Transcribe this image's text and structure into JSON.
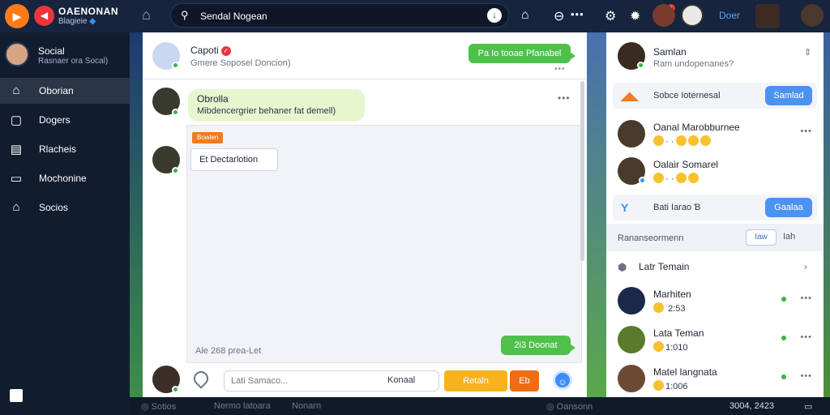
{
  "topbar": {
    "brand": "OAENONAN",
    "brand_sub": "Blagieie",
    "search_query": "Sendal Nogean",
    "link_text": "Doer"
  },
  "sidebar": {
    "profile_name": "Social",
    "profile_sub": "Rasnaer ora Socal)",
    "items": [
      {
        "label": "Oborian",
        "icon": "home-icon"
      },
      {
        "label": "Dogers",
        "icon": "square-icon"
      },
      {
        "label": "Rlacheis",
        "icon": "list-icon"
      },
      {
        "label": "Mochonine",
        "icon": "folder-icon"
      },
      {
        "label": "Socios",
        "icon": "store-icon"
      }
    ]
  },
  "chat": {
    "contact_name": "Capoti",
    "contact_status": "Gmere Soposel Doncion)",
    "header_pill": "Pa Io tooae Pfanabel",
    "bubble_name": "Obrolla",
    "bubble_text": "Mibdencergrier behaner fat demell)",
    "tag": "Bowlen",
    "card_text": "Et Dectarlotion",
    "hint": "Ale 268 prea-Let",
    "sent_pill": "2i3 Doonat",
    "input_placeholder": "Lati Samaco...",
    "input_label": "Konaal",
    "send_button": "Retaln",
    "small_button": "Eb"
  },
  "right": {
    "name": "Samlan",
    "status": "Ram undopenanes?",
    "row1_label": "Sobce Ioternesal",
    "row1_button": "Samlad",
    "people_top": [
      {
        "name": "Oanal Marobburnee",
        "emoji_count": "4"
      },
      {
        "name": "Oalair Somarel",
        "emoji_count": "3"
      }
    ],
    "row2_label": "Bati Iarao Ɓ",
    "row2_button": "Gaalaa",
    "section_label": "Rananseormenn",
    "section_btn1": "Iaw",
    "section_btn2": "Iah",
    "latest_label": "Latr Temain",
    "people_bottom": [
      {
        "name": "Marhiten",
        "meta": "2:53"
      },
      {
        "name": "Lata Teman",
        "meta": "1:010"
      },
      {
        "name": "Matel langnata",
        "meta": "1:006"
      }
    ]
  },
  "bottombar": {
    "items": [
      "Sotios",
      "Nermo latoara",
      "Nonarn",
      "Oansonn"
    ],
    "right_text": "3004, 2423"
  }
}
